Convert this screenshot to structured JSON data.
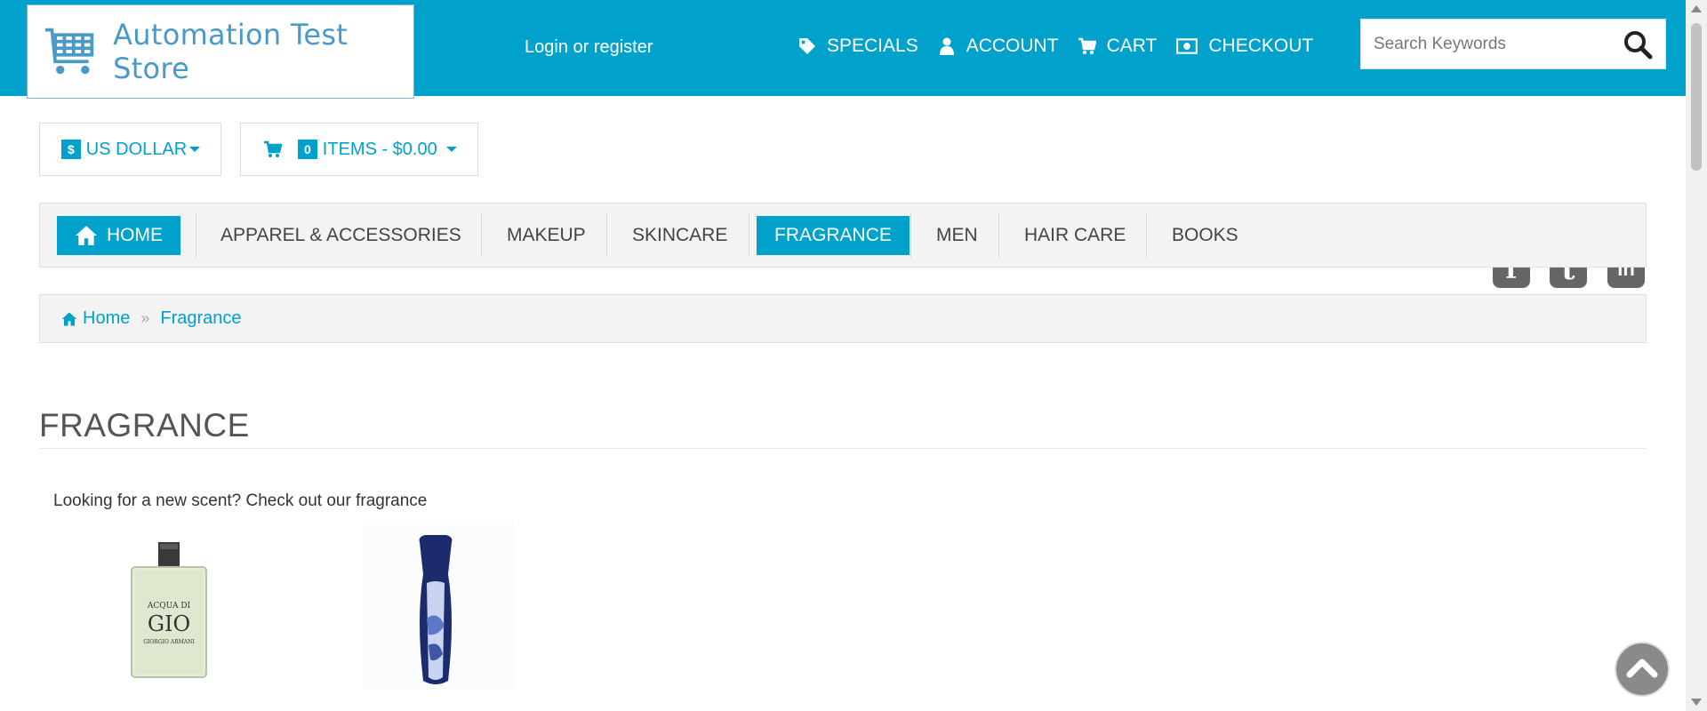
{
  "header": {
    "logo_text": "Automation Test Store",
    "login_label": "Login or register",
    "nav": [
      {
        "label": "SPECIALS",
        "icon": "tag-icon"
      },
      {
        "label": "ACCOUNT",
        "icon": "user-icon"
      },
      {
        "label": "CART",
        "icon": "cart-icon"
      },
      {
        "label": "CHECKOUT",
        "icon": "money-icon"
      }
    ],
    "search_placeholder": "Search Keywords"
  },
  "currency": {
    "symbol": "$",
    "label": "US DOLLAR"
  },
  "cart_summary": {
    "count": "0",
    "label": "ITEMS - $0.00"
  },
  "social": [
    "facebook-icon",
    "twitter-icon",
    "linkedin-icon"
  ],
  "menu": {
    "items": [
      {
        "label": "HOME",
        "active": true
      },
      {
        "label": "APPAREL & ACCESSORIES",
        "active": false
      },
      {
        "label": "MAKEUP",
        "active": false
      },
      {
        "label": "SKINCARE",
        "active": false
      },
      {
        "label": "FRAGRANCE",
        "active": true
      },
      {
        "label": "MEN",
        "active": false
      },
      {
        "label": "HAIR CARE",
        "active": false
      },
      {
        "label": "BOOKS",
        "active": false
      }
    ]
  },
  "breadcrumb": {
    "home": "Home",
    "current": "Fragrance"
  },
  "page": {
    "title": "FRAGRANCE",
    "description": "Looking for a new scent? Check out our fragrance"
  },
  "products": [
    {
      "label_line1": "ACQUA DI",
      "label_line2": "GIO",
      "label_line3": "GIORGIO ARMANI"
    },
    {
      "label_line1": "",
      "label_line2": "",
      "label_line3": ""
    }
  ],
  "colors": {
    "accent": "#00a1cb",
    "menu_bg": "#f3f3f3"
  }
}
